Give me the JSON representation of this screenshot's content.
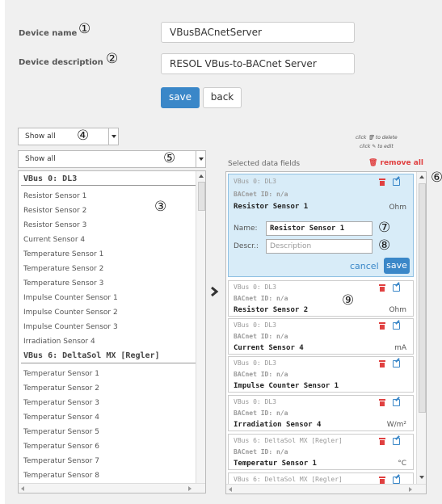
{
  "device": {
    "name_label": "Device name",
    "name_value": "VBusBACnetServer",
    "desc_label": "Device description",
    "desc_value": "RESOL VBus-to-BACnet Server",
    "save": "save",
    "back": "back"
  },
  "markers": [
    "①",
    "②",
    "③",
    "④",
    "⑤",
    "⑥",
    "⑦",
    "⑧",
    "⑨"
  ],
  "filters": {
    "filter1": "Show all",
    "filter2": "Show all"
  },
  "hints": {
    "delete_hint": "click 🗑 to delete",
    "edit_hint": "click ✎ to edit"
  },
  "selected_title": "Selected data fields",
  "remove_all": "🗑 remove all",
  "available": [
    {
      "group": "VBus 0: DL3",
      "items": [
        "Resistor Sensor 1",
        "Resistor Sensor 2",
        "Resistor Sensor 3",
        "Current Sensor 4",
        "Temperature Sensor 1",
        "Temperature Sensor 2",
        "Temperature Sensor 3",
        "Impulse Counter Sensor 1",
        "Impulse Counter Sensor 2",
        "Impulse Counter Sensor 3",
        "Irradiation Sensor 4"
      ]
    },
    {
      "group": "VBus 6: DeltaSol MX [Regler]",
      "items": [
        "Temperatur Sensor 1",
        "Temperatur Sensor 2",
        "Temperatur Sensor 3",
        "Temperatur Sensor 4",
        "Temperatur Sensor 5",
        "Temperatur Sensor 6",
        "Temperatur Sensor 7",
        "Temperatur Sensor 8"
      ]
    }
  ],
  "selected": [
    {
      "title": "VBus 0: DL3",
      "bacnet": "BACnet ID: n/a",
      "name": "Resistor Sensor 1",
      "unit": "Ohm"
    },
    {
      "title": "VBus 0: DL3",
      "bacnet": "BACnet ID: n/a",
      "name": "Resistor Sensor 2",
      "unit": "Ohm"
    },
    {
      "title": "VBus 0: DL3",
      "bacnet": "BACnet ID: n/a",
      "name": "Current Sensor 4",
      "unit": "mA"
    },
    {
      "title": "VBus 0: DL3",
      "bacnet": "BACnet ID: n/a",
      "name": "Impulse Counter Sensor 1",
      "unit": ""
    },
    {
      "title": "VBus 0: DL3",
      "bacnet": "BACnet ID: n/a",
      "name": "Irradiation Sensor 4",
      "unit": "W/m²"
    },
    {
      "title": "VBus 6: DeltaSol MX [Regler]",
      "bacnet": "BACnet ID: n/a",
      "name": "Temperatur Sensor 1",
      "unit": "°C"
    },
    {
      "title": "VBus 6: DeltaSol MX [Regler]"
    }
  ],
  "edit_form": {
    "name_label": "Name:",
    "name_value": "Resistor Sensor 1",
    "desc_label": "Descr.:",
    "desc_placeholder": "Description",
    "cancel": "cancel",
    "save": "save"
  },
  "colors": {
    "accent": "#3a87c8",
    "danger": "#e04040",
    "active_card": "#d8ecf8"
  }
}
